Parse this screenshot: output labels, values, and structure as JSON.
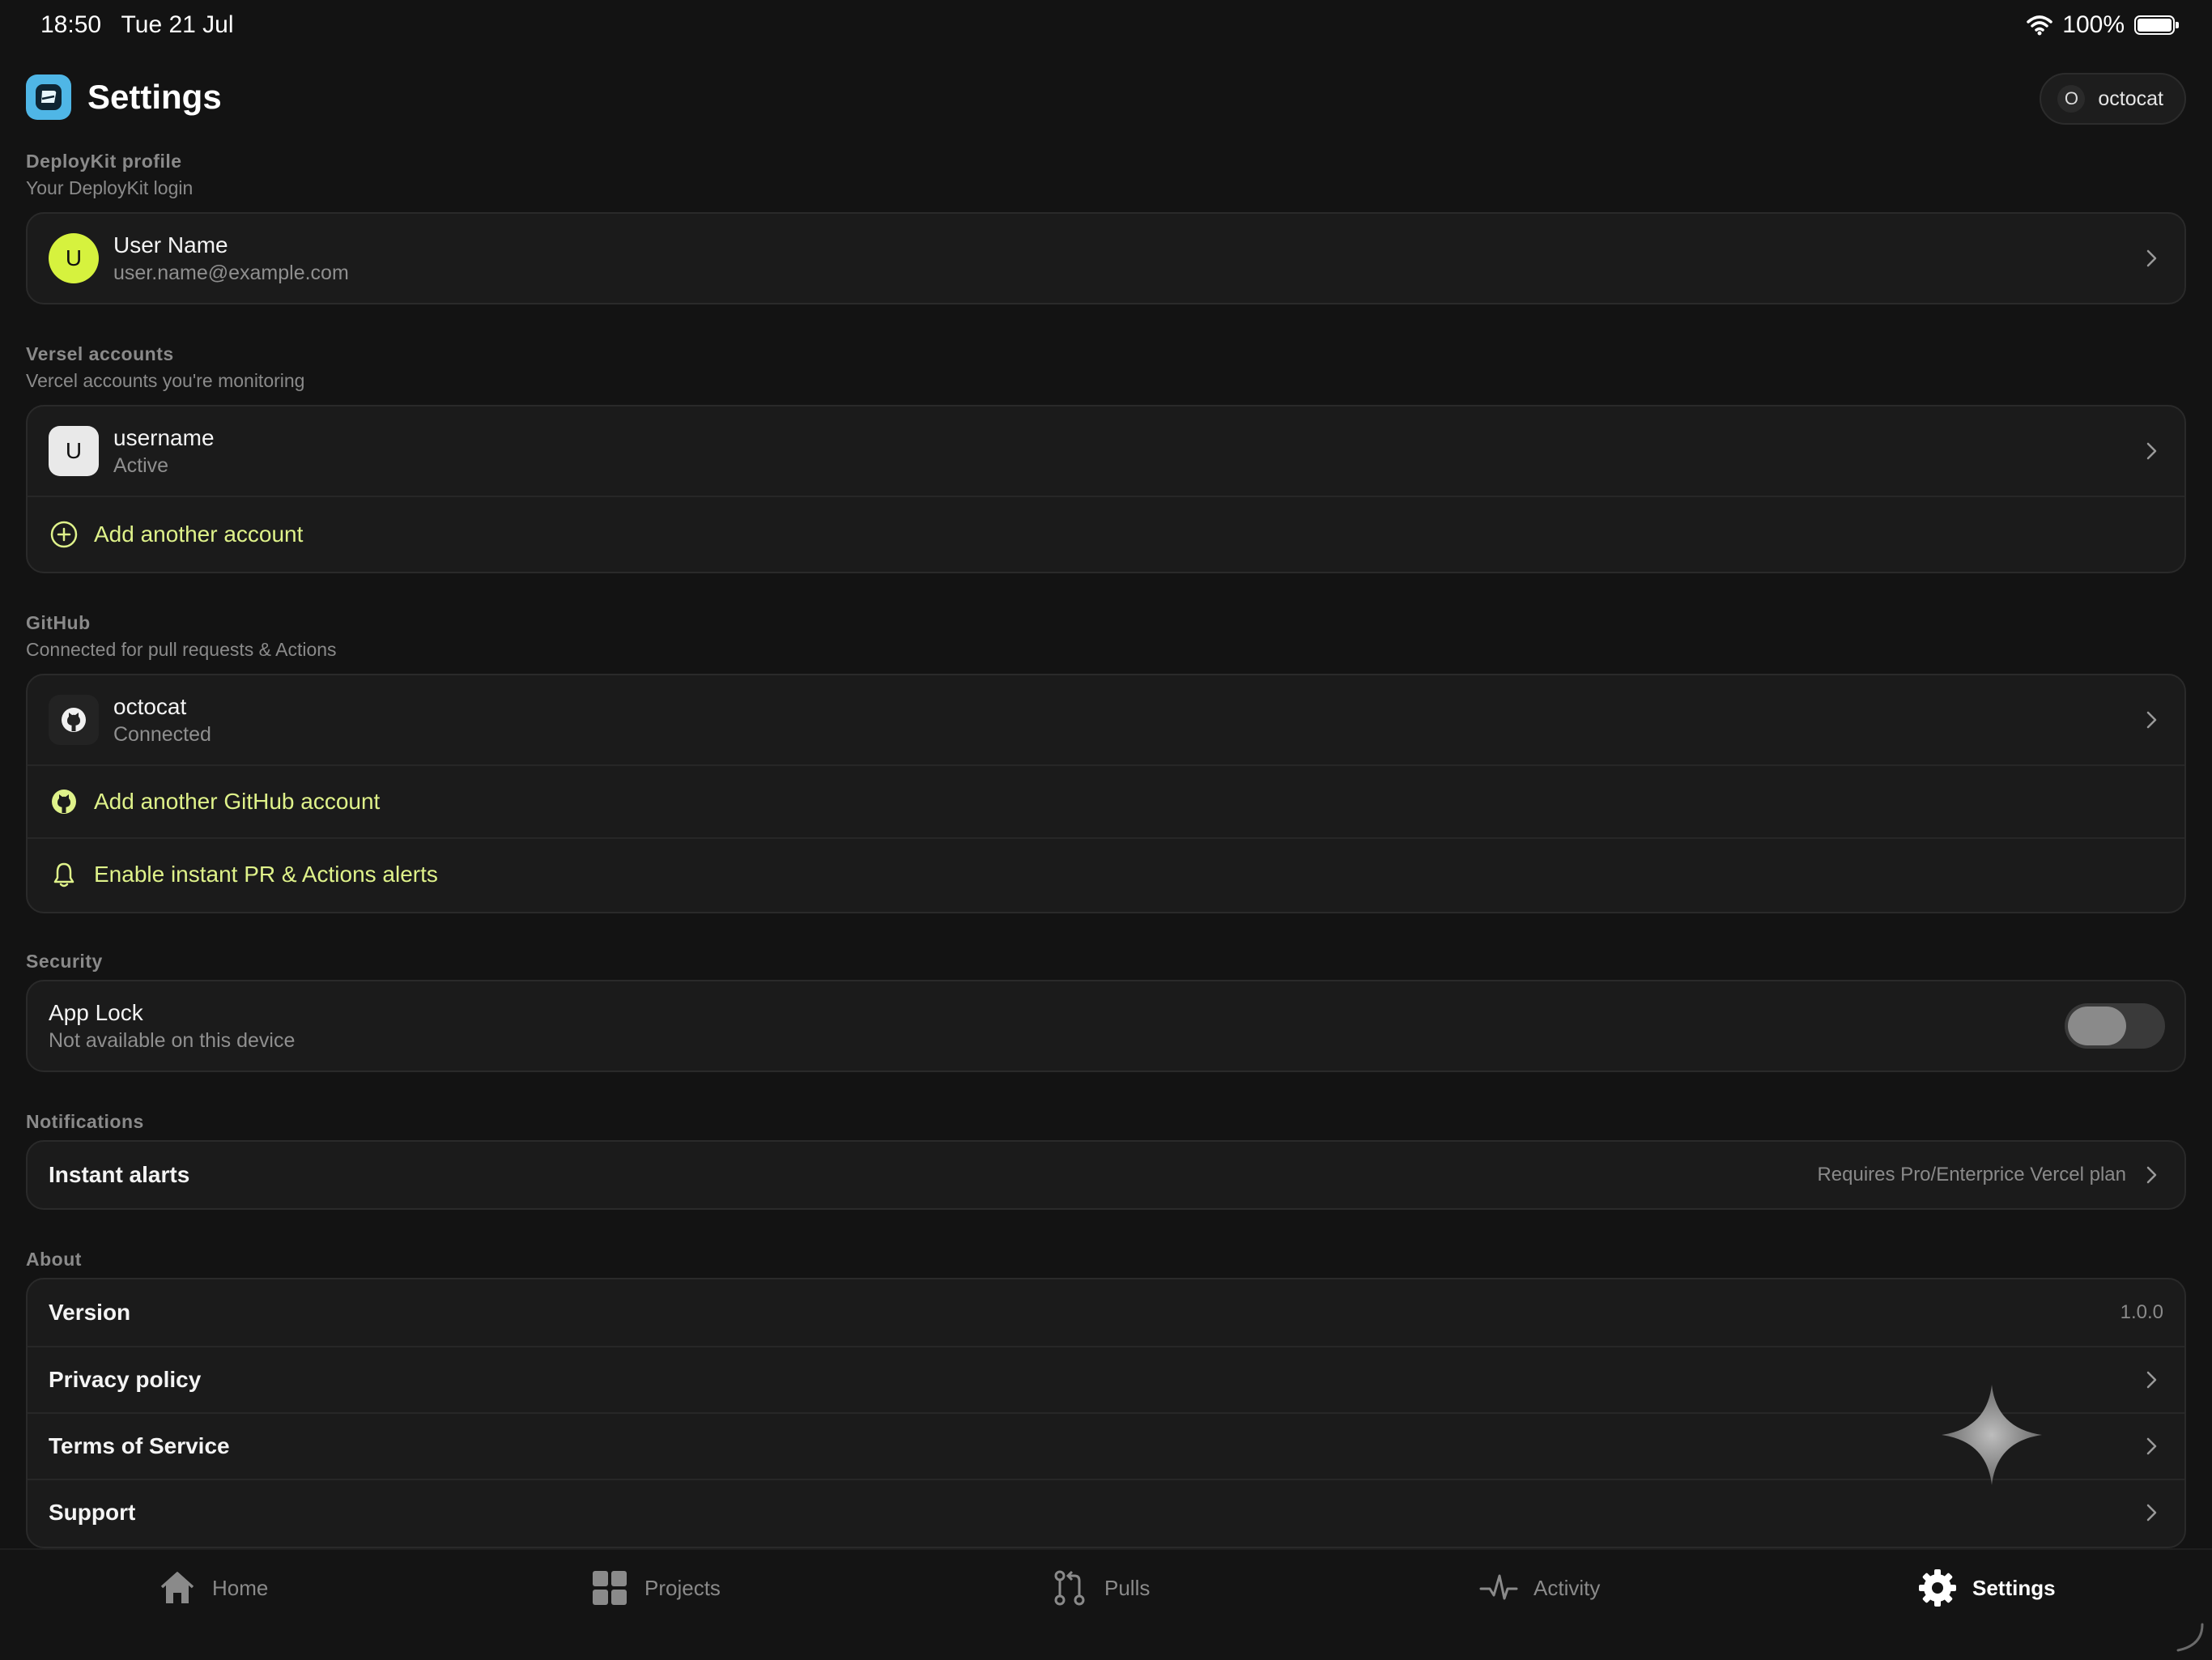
{
  "status_bar": {
    "time": "18:50",
    "date": "Tue 21 Jul",
    "battery": "100%"
  },
  "header": {
    "title": "Settings",
    "user_chip": {
      "initial": "O",
      "name": "octocat"
    }
  },
  "profile_section": {
    "title": "DeployKit profile",
    "subtitle": "Your DeployKit login",
    "user": {
      "initial": "U",
      "name": "User Name",
      "email": "user.name@example.com"
    }
  },
  "vercel_section": {
    "title": "Versel accounts",
    "subtitle": "Vercel accounts you're monitoring",
    "account": {
      "initial": "U",
      "name": "username",
      "status": "Active"
    },
    "add_label": "Add another account"
  },
  "github_section": {
    "title": "GitHub",
    "subtitle": "Connected for pull requests & Actions",
    "account": {
      "name": "octocat",
      "status": "Connected"
    },
    "add_label": "Add another GitHub account",
    "alerts_label": "Enable instant PR & Actions alerts"
  },
  "security_section": {
    "title": "Security",
    "app_lock": {
      "label": "App Lock",
      "note": "Not available on this device",
      "enabled": false
    }
  },
  "notifications_section": {
    "title": "Notifications",
    "instant_alerts": {
      "label": "Instant alarts",
      "note": "Requires Pro/Enterprice Vercel plan"
    }
  },
  "about_section": {
    "title": "About",
    "version_label": "Version",
    "version_value": "1.0.0",
    "privacy_label": "Privacy policy",
    "terms_label": "Terms of Service",
    "support_label": "Support"
  },
  "tab_bar": {
    "active": "Settings",
    "home": "Home",
    "projects": "Projects",
    "pulls": "Pulls",
    "activity": "Activity",
    "settings": "Settings"
  },
  "colors": {
    "accent": "#dff28a",
    "avatar_lime": "#d6f23e",
    "app_logo": "#4fb6e6",
    "background": "#131313",
    "card": "#1b1b1b"
  }
}
